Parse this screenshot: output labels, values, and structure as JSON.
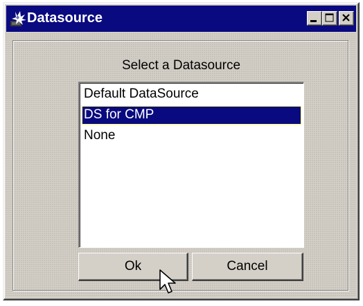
{
  "window": {
    "title": "Datasource",
    "icon": "java-cup-icon",
    "controls": {
      "minimize": "minimize-icon",
      "maximize": "maximize-icon",
      "close": "close-icon"
    }
  },
  "dialog": {
    "prompt": "Select a Datasource",
    "items": [
      {
        "label": "Default DataSource",
        "selected": false
      },
      {
        "label": "DS for CMP",
        "selected": true
      },
      {
        "label": "None",
        "selected": false
      }
    ],
    "ok_label": "Ok",
    "cancel_label": "Cancel"
  },
  "colors": {
    "titlebar": "#0a0a80",
    "selection": "#0a0a80",
    "face": "#d4d0c8"
  },
  "cursor": "arrow-cursor-icon"
}
